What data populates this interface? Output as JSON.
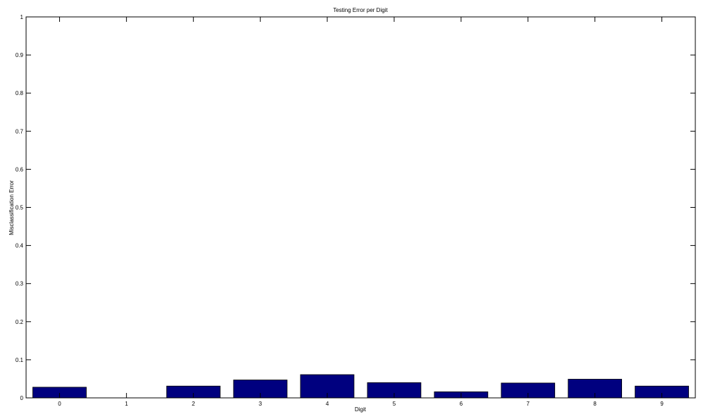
{
  "chart_data": {
    "type": "bar",
    "title": "Testing Error per Digit",
    "xlabel": "Digit",
    "ylabel": "Misclassification Error",
    "categories": [
      "0",
      "1",
      "2",
      "3",
      "4",
      "5",
      "6",
      "7",
      "8",
      "9"
    ],
    "values": [
      0.028,
      0.0,
      0.031,
      0.047,
      0.061,
      0.04,
      0.016,
      0.039,
      0.049,
      0.031
    ],
    "ylim": [
      0,
      1
    ],
    "yticks": [
      "0",
      "0.1",
      "0.2",
      "0.3",
      "0.4",
      "0.5",
      "0.6",
      "0.7",
      "0.8",
      "0.9",
      "1"
    ],
    "grid": false,
    "legend": "none",
    "bar_color": "#00007f",
    "edge_color": "#000000"
  }
}
